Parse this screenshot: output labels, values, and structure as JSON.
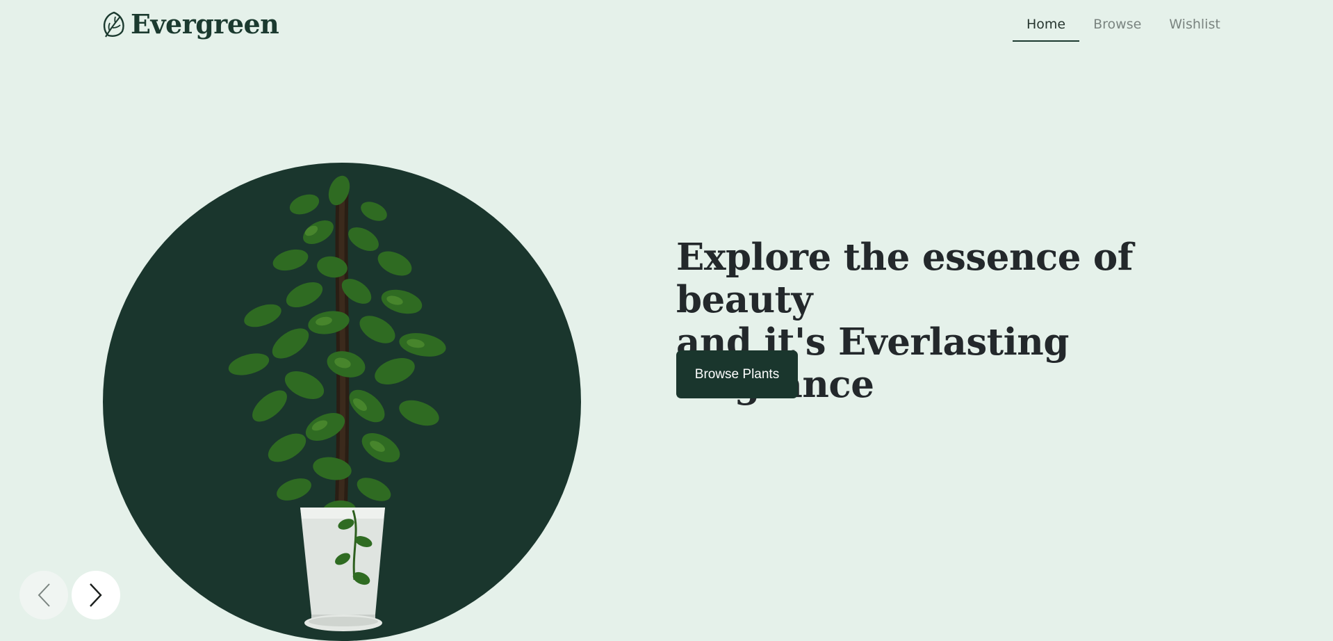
{
  "brand": {
    "name": "Evergreen",
    "color": "#1b3a2f"
  },
  "nav": {
    "items": [
      {
        "label": "Home",
        "active": true
      },
      {
        "label": "Browse",
        "active": false
      },
      {
        "label": "Wishlist",
        "active": false
      }
    ]
  },
  "hero": {
    "headline_line1": "Explore the essence of beauty",
    "headline_line2": "and it's Everlasting fragrance",
    "cta_label": "Browse Plants",
    "image": "potted-pothos-plant"
  },
  "carousel": {
    "prev_icon": "chevron-left-icon",
    "next_icon": "chevron-right-icon"
  },
  "colors": {
    "background": "#e5f1ea",
    "accent_dark": "#1a362d",
    "text_dark": "#23282b",
    "nav_inactive": "#7a8480"
  }
}
